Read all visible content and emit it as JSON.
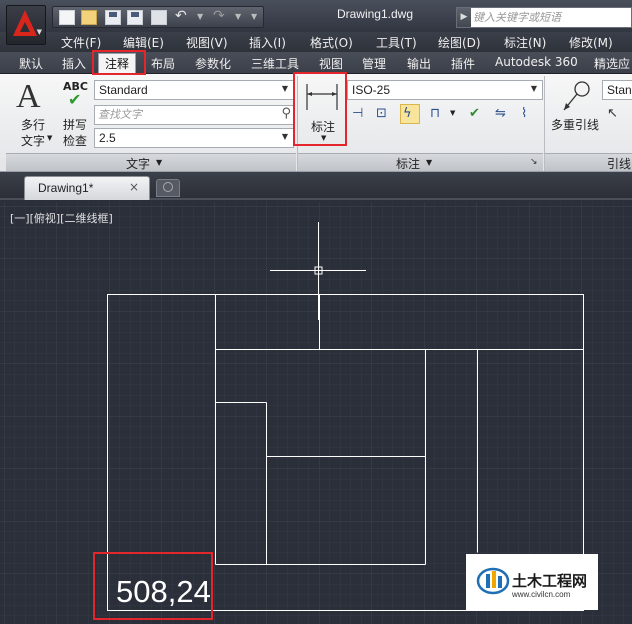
{
  "titlebar": {
    "doc_title": "Drawing1.dwg",
    "search_placeholder": "键入关键字或短语"
  },
  "menu": [
    "文件(F)",
    "编辑(E)",
    "视图(V)",
    "插入(I)",
    "格式(O)",
    "工具(T)",
    "绘图(D)",
    "标注(N)",
    "修改(M)"
  ],
  "ribbon_tabs": [
    "默认",
    "插入",
    "注释",
    "布局",
    "参数化",
    "三维工具",
    "视图",
    "管理",
    "输出",
    "插件",
    "Autodesk 360",
    "精选应"
  ],
  "ribbon": {
    "text_panel": {
      "multiline_text": "多行",
      "multiline_text2": "文字",
      "check_icon_text": "ABC",
      "spell_check": "拼写",
      "spell_check2": "检查",
      "style_value": "Standard",
      "find_placeholder": "查找文字",
      "height_value": "2.5",
      "title": "文字"
    },
    "dim_panel": {
      "dimension_label": "标注",
      "style_value": "ISO-25",
      "title": "标注"
    },
    "leader_panel": {
      "multileader": "多重引线",
      "style_value": "Stan",
      "title": "引线"
    }
  },
  "filetabs": {
    "active_tab": "Drawing1*",
    "close_glyph": "×"
  },
  "canvas": {
    "viewport_label": "[一][俯视][二维线框]",
    "coordinate_readout": "508,24"
  },
  "watermark": {
    "title": "土木工程网",
    "url": "www.civilcn.com"
  },
  "colors": {
    "canvas_bg": "#2b2f3a",
    "highlight": "#e3262b",
    "linework": "#ffffff"
  }
}
